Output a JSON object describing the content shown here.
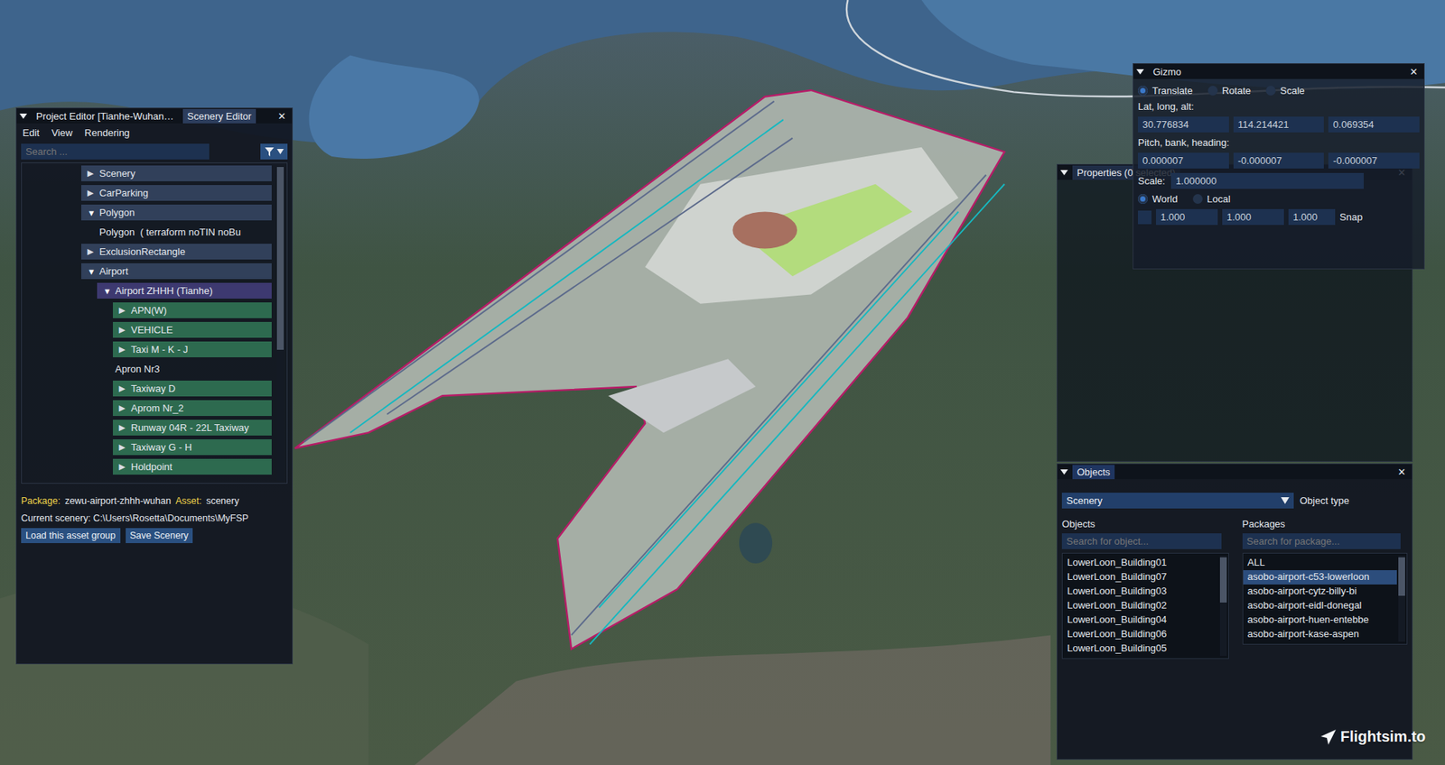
{
  "project_editor": {
    "tabs": [
      {
        "label": "Project Editor [Tianhe-Wuhan…",
        "selected": false
      },
      {
        "label": "Scenery Editor",
        "selected": true
      }
    ],
    "close": "✕",
    "menu": [
      "Edit",
      "View",
      "Rendering"
    ],
    "search": {
      "placeholder": "Search ..."
    },
    "tree": [
      {
        "arrow": "▶",
        "label": "Scenery",
        "kind": "group",
        "expanded": false,
        "selected": false
      },
      {
        "arrow": "▶",
        "label": "CarParking",
        "kind": "group",
        "expanded": false,
        "selected": false
      },
      {
        "arrow": "▼",
        "label": "Polygon",
        "kind": "group",
        "expanded": true,
        "selected": false,
        "children": [
          {
            "label": "Polygon  ( terraform noTIN noBu",
            "kind": "leaf",
            "selected": false
          }
        ]
      },
      {
        "arrow": "▶",
        "label": "ExclusionRectangle",
        "kind": "group",
        "expanded": false,
        "selected": false
      },
      {
        "arrow": "▼",
        "label": "Airport",
        "kind": "group",
        "expanded": true,
        "selected": false,
        "children": [
          {
            "arrow": "▼",
            "label": "Airport ZHHH (Tianhe)",
            "kind": "group",
            "expanded": true,
            "selected": true,
            "children": [
              {
                "arrow": "▶",
                "label": "APN(W)",
                "kind": "layer",
                "expanded": false,
                "selected": false
              },
              {
                "arrow": "▶",
                "label": "VEHICLE",
                "kind": "layer",
                "expanded": false,
                "selected": false
              },
              {
                "arrow": "▶",
                "label": "Taxi M - K - J",
                "kind": "layer",
                "expanded": false,
                "selected": false
              },
              {
                "label": "Apron Nr3",
                "kind": "leaf",
                "selected": false
              },
              {
                "arrow": "▶",
                "label": "Taxiway D",
                "kind": "layer",
                "expanded": false,
                "selected": false
              },
              {
                "arrow": "▶",
                "label": "Aprom Nr_2",
                "kind": "layer",
                "expanded": false,
                "selected": false
              },
              {
                "arrow": "▶",
                "label": "Runway 04R - 22L Taxiway",
                "kind": "layer",
                "expanded": false,
                "selected": false
              },
              {
                "arrow": "▶",
                "label": "Taxiway G - H",
                "kind": "layer",
                "expanded": false,
                "selected": false
              },
              {
                "arrow": "▶",
                "label": "Holdpoint",
                "kind": "layer",
                "expanded": false,
                "selected": false
              }
            ]
          }
        ]
      }
    ],
    "package_label": "Package:",
    "package": "zewu-airport-zhhh-wuhan",
    "asset_label": "Asset:",
    "asset": "scenery",
    "current_scenery": "Current scenery: C:\\Users\\Rosetta\\Documents\\MyFSP",
    "buttons": [
      "Load this asset group",
      "Save Scenery"
    ]
  },
  "gizmo": {
    "title": "Gizmo",
    "close": "✕",
    "modes": [
      {
        "label": "Translate",
        "selected": true
      },
      {
        "label": "Rotate",
        "selected": false
      },
      {
        "label": "Scale",
        "selected": false
      }
    ],
    "position": {
      "label": "Lat, long, alt:",
      "values": [
        "30.776834",
        "114.214421",
        "0.069354"
      ]
    },
    "rotation": {
      "label": "Pitch, bank, heading:",
      "values": [
        "0.000007",
        "-0.000007",
        "-0.000007"
      ]
    },
    "scale": {
      "label": "Scale:",
      "value": "1.000000"
    },
    "spaces": [
      {
        "label": "World",
        "selected": true
      },
      {
        "label": "Local",
        "selected": false
      }
    ],
    "snap": {
      "checked": false,
      "values": [
        "1.000",
        "1.000",
        "1.000"
      ],
      "label": "Snap"
    }
  },
  "properties": {
    "title": "Properties (0 selected)",
    "close": "✕"
  },
  "objects": {
    "title": "Objects",
    "close": "✕",
    "object_type": {
      "value": "Scenery",
      "label": "Object type"
    },
    "objects_header": "Objects",
    "packages_header": "Packages",
    "object_search": {
      "placeholder": "Search for object..."
    },
    "package_search": {
      "placeholder": "Search for package..."
    },
    "object_items": [
      {
        "label": "LowerLoon_Building01",
        "selected": false
      },
      {
        "label": "LowerLoon_Building07",
        "selected": false
      },
      {
        "label": "LowerLoon_Building03",
        "selected": false
      },
      {
        "label": "LowerLoon_Building02",
        "selected": false
      },
      {
        "label": "LowerLoon_Building04",
        "selected": false
      },
      {
        "label": "LowerLoon_Building06",
        "selected": false
      },
      {
        "label": "LowerLoon_Building05",
        "selected": false
      }
    ],
    "package_items": [
      {
        "label": "ALL",
        "selected": false
      },
      {
        "label": "asobo-airport-c53-lowerloon",
        "selected": true
      },
      {
        "label": "asobo-airport-cytz-billy-bi",
        "selected": false
      },
      {
        "label": "asobo-airport-eidl-donegal",
        "selected": false
      },
      {
        "label": "asobo-airport-huen-entebbe",
        "selected": false
      },
      {
        "label": "asobo-airport-kase-aspen",
        "selected": false
      }
    ]
  },
  "watermark": "Flightsim.to"
}
